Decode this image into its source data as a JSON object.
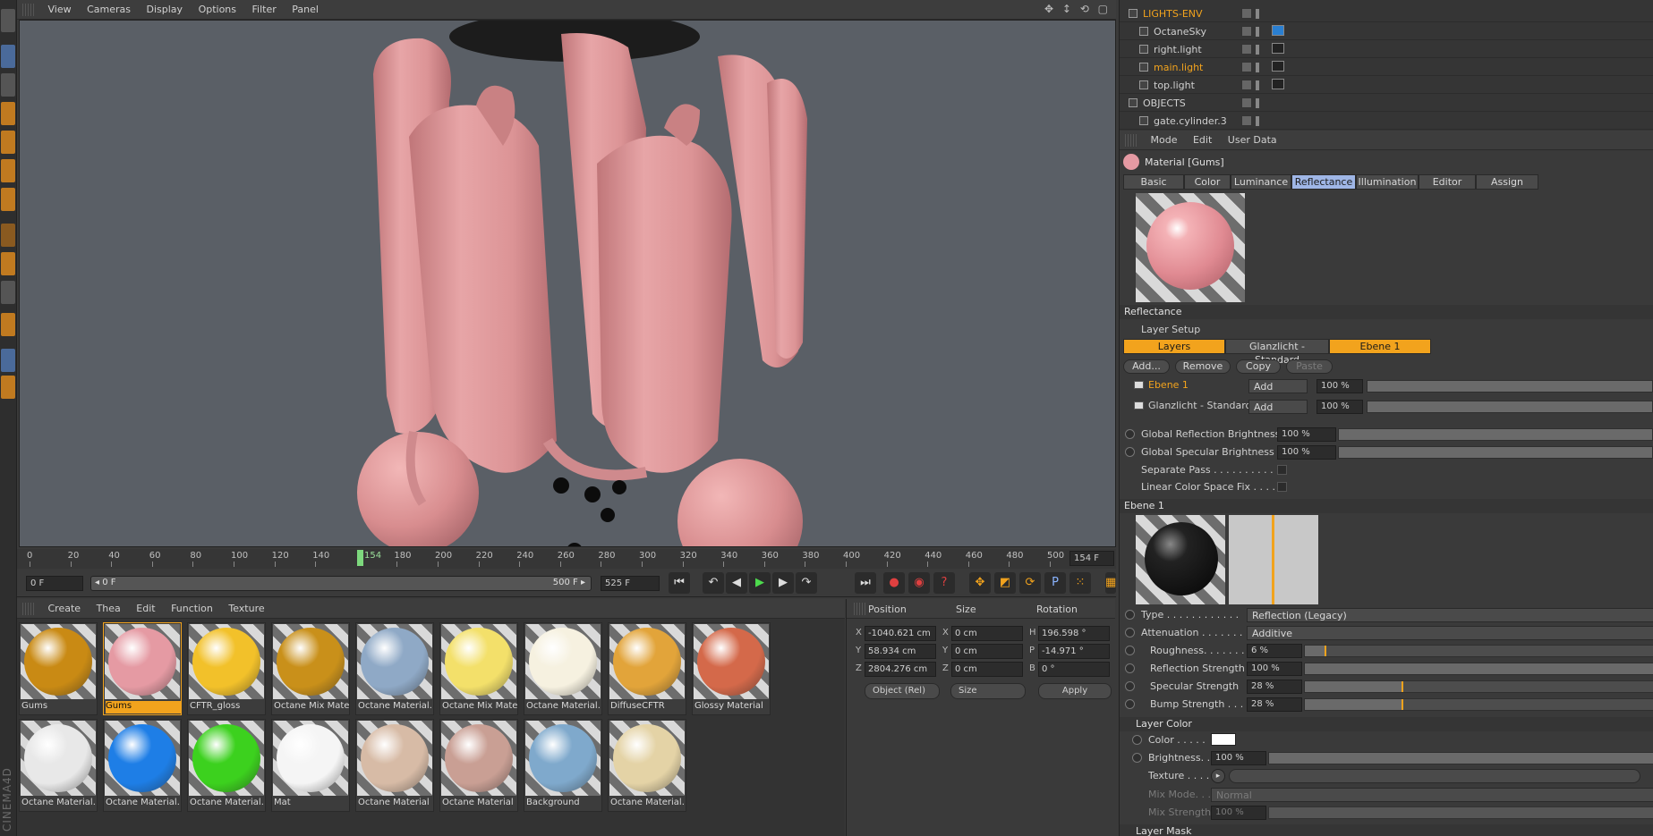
{
  "viewport": {
    "menu": [
      "View",
      "Cameras",
      "Display",
      "Options",
      "Filter",
      "Panel"
    ],
    "nav_icons": "✥ ↕ ⟲ ▢"
  },
  "timeline": {
    "ticks": [
      "0",
      "20",
      "40",
      "60",
      "80",
      "100",
      "120",
      "140",
      "154",
      "180",
      "200",
      "220",
      "240",
      "260",
      "280",
      "300",
      "320",
      "340",
      "360",
      "380",
      "400",
      "420",
      "440",
      "460",
      "480",
      "500"
    ],
    "current_frame": "154",
    "current_frame_field": "154 F",
    "start_field": "0 F",
    "range_start": "◂ 0 F",
    "range_end": "500 F ▸",
    "end_field": "525 F"
  },
  "transport": {
    "first": "⏮",
    "prev_key": "↶",
    "prev": "◀",
    "play": "▶",
    "next": "▶",
    "next_key": "↷",
    "last": "⏭",
    "record": "●",
    "auto_key": "◉",
    "help": "?",
    "move": "✥",
    "scale": "◩",
    "rotate": "⟳",
    "param": "P",
    "dots": "⁙",
    "film": "▦"
  },
  "materials": {
    "menu": [
      "Create",
      "Thea",
      "Edit",
      "Function",
      "Texture"
    ],
    "items": [
      {
        "label": "Gums",
        "color": "#c98a14"
      },
      {
        "label": "Gums",
        "color": "#e59aa3",
        "selected": true
      },
      {
        "label": "CFTR_gloss",
        "color": "#f2c12a"
      },
      {
        "label": "Octane Mix Mate",
        "color": "#c9901a"
      },
      {
        "label": "Octane Material.",
        "color": "#8fa9c6"
      },
      {
        "label": "Octane Mix Mate",
        "color": "#f3e06a"
      },
      {
        "label": "Octane Material.",
        "color": "#f6f1e0"
      },
      {
        "label": "DiffuseCFTR",
        "color": "#e2a43a"
      },
      {
        "label": "Glossy Material",
        "color": "#d4694a"
      },
      {
        "label": "Octane Material.",
        "color": "#e8e8e8"
      },
      {
        "label": "Octane Material.",
        "color": "#1e7ee6"
      },
      {
        "label": "Octane Material.",
        "color": "#3cd11e"
      },
      {
        "label": "Mat",
        "color": "#f5f5f5"
      },
      {
        "label": "Octane Material",
        "color": "#d7bba6"
      },
      {
        "label": "Octane Material",
        "color": "#c99f94"
      },
      {
        "label": "Background",
        "color": "#7fa9cc"
      },
      {
        "label": "Octane Material.",
        "color": "#e4d3a6"
      }
    ]
  },
  "coords": {
    "headers": [
      "Position",
      "Size",
      "Rotation"
    ],
    "x_pos": "-1040.621 cm",
    "y_pos": "58.934 cm",
    "z_pos": "2804.276 cm",
    "x_size": "0 cm",
    "y_size": "0 cm",
    "z_size": "0 cm",
    "h_rot": "196.598 °",
    "p_rot": "-14.971 °",
    "b_rot": "0 °",
    "labels": {
      "x": "X",
      "y": "Y",
      "z": "Z",
      "h": "H",
      "p": "P",
      "b": "B"
    },
    "mode": "Object (Rel)",
    "size_mode": "Size",
    "apply": "Apply"
  },
  "objects": {
    "rows": [
      {
        "name": "LIGHTS-ENV",
        "color": "#f2a31d"
      },
      {
        "name": "OctaneSky",
        "color": "#d0d0d0"
      },
      {
        "name": "right.light",
        "color": "#d0d0d0"
      },
      {
        "name": "main.light",
        "color": "#f2a31d"
      },
      {
        "name": "top.light",
        "color": "#d0d0d0"
      },
      {
        "name": "OBJECTS",
        "color": "#d0d0d0"
      },
      {
        "name": "gate.cylinder.3",
        "color": "#d0d0d0"
      }
    ]
  },
  "attributes": {
    "menu": [
      "Mode",
      "Edit",
      "User Data"
    ],
    "material_title": "Material [Gums]",
    "tabs": [
      "Basic",
      "Color",
      "Luminance",
      "Reflectance",
      "Illumination",
      "Editor",
      "Assign"
    ],
    "active_tab": "Reflectance",
    "reflectance_section": "Reflectance",
    "layer_setup": "Layer Setup",
    "layer_tabs": [
      "Layers",
      "Glanzlicht - Standard",
      "Ebene 1"
    ],
    "buttons": {
      "add": "Add...",
      "remove": "Remove",
      "copy": "Copy",
      "paste": "Paste"
    },
    "layers": [
      {
        "name": "Ebene 1",
        "mode": "Add",
        "value": "100 %"
      },
      {
        "name": "Glanzlicht - Standard",
        "mode": "Add",
        "value": "100 %"
      }
    ],
    "global_reflection": {
      "label": "Global Reflection Brightness",
      "value": "100 %"
    },
    "global_specular": {
      "label": "Global Specular Brightness",
      "value": "100 %"
    },
    "separate_pass": "Separate Pass . . . . . . . . . . . .",
    "linear_fix": "Linear Color Space Fix . . . . .",
    "ebene_section": "Ebene 1",
    "type": {
      "label": "Type . . . . . . . . . . . .",
      "value": "Reflection (Legacy)"
    },
    "attenuation": {
      "label": "Attenuation . . . . . . . .",
      "value": "Additive"
    },
    "roughness": {
      "label": "Roughness. . . . . . .",
      "value": "6 %",
      "level": 0.06
    },
    "reflection_strength": {
      "label": "Reflection Strength",
      "value": "100 %",
      "level": 1.0
    },
    "specular_strength": {
      "label": "Specular Strength",
      "value": "28 %",
      "level": 0.28
    },
    "bump_strength": {
      "label": "Bump Strength . . .",
      "value": "28 %",
      "level": 0.28
    },
    "layer_color_section": "Layer Color",
    "color_label": "Color . . . . .",
    "brightness": {
      "label": "Brightness. .",
      "value": "100 %"
    },
    "texture_label": "Texture . . . . .",
    "mix_mode": {
      "label": "Mix Mode. . . . .",
      "value": "Normal"
    },
    "mix_strength": {
      "label": "Mix Strength",
      "value": "100 %"
    },
    "layer_mask": "Layer Mask"
  },
  "branding": "CINEMA4D"
}
